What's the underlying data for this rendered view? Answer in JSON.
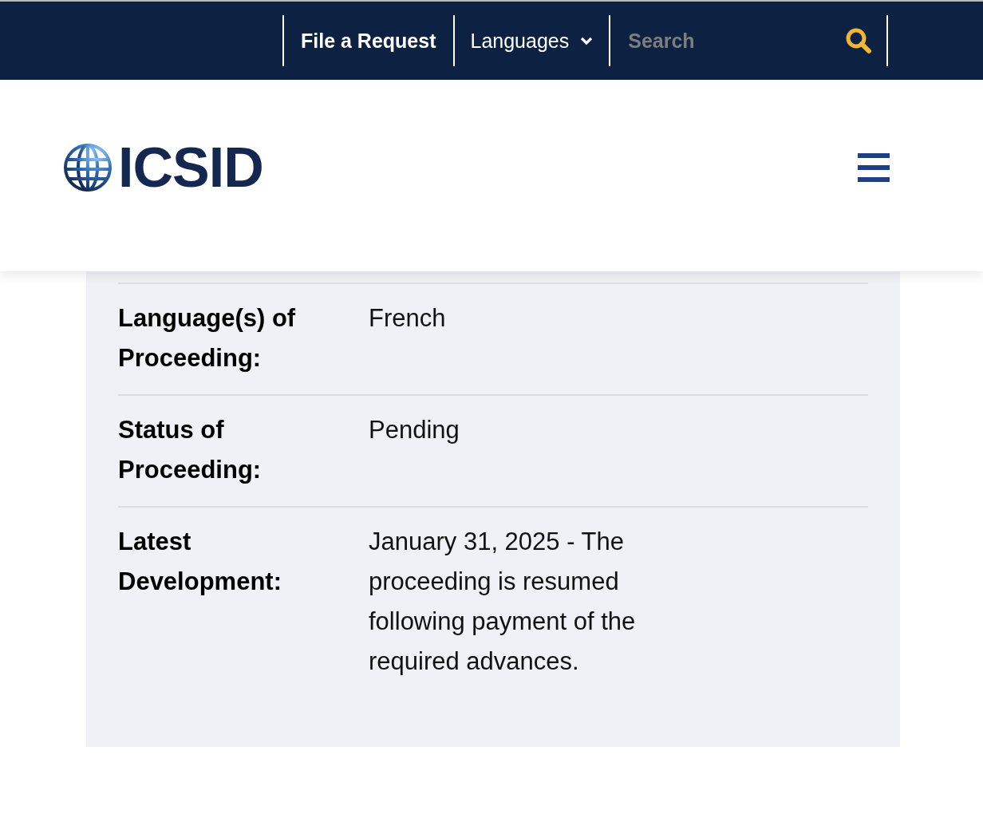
{
  "top_bar": {
    "request_link": "File a Request",
    "languages_menu": "Languages",
    "search": {
      "placeholder": "Search"
    }
  },
  "header": {
    "logo_text": "ICSID"
  },
  "details": [
    {
      "label": "Language(s) of Proceeding:",
      "value": "French"
    },
    {
      "label": "Status of Proceeding:",
      "value": "Pending"
    },
    {
      "label": "Latest Development:",
      "value": "January 31, 2025 - The proceeding is resumed following payment of the required advances."
    }
  ]
}
